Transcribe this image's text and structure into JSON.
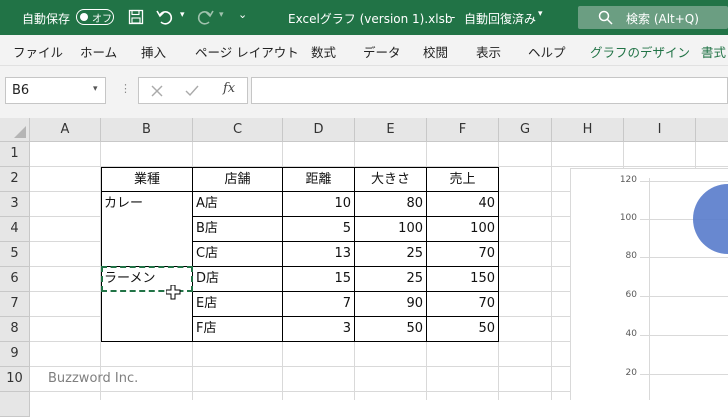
{
  "titlebar": {
    "autosave_label": "自動保存",
    "autosave_state": "オフ",
    "file_title": "Excelグラフ (version 1).xlsb",
    "save_status": "自動回復済み",
    "search_placeholder": "検索 (Alt+Q)"
  },
  "ribbon": {
    "tabs": [
      "ファイル",
      "ホーム",
      "挿入",
      "ページ レイアウト",
      "数式",
      "データ",
      "校閲",
      "表示",
      "ヘルプ",
      "グラフのデザイン",
      "書式"
    ]
  },
  "formula_bar": {
    "name_box": "B6",
    "fx": "fx",
    "value": ""
  },
  "grid": {
    "columns": [
      "A",
      "B",
      "C",
      "D",
      "E",
      "F",
      "G",
      "H",
      "I"
    ],
    "rows": [
      "1",
      "2",
      "3",
      "4",
      "5",
      "6",
      "7",
      "8",
      "9",
      "10"
    ],
    "table": {
      "headers": [
        "業種",
        "店舗",
        "距離",
        "大きさ",
        "売上"
      ],
      "rows": [
        [
          "カレー",
          "A店",
          "10",
          "80",
          "40"
        ],
        [
          "",
          "B店",
          "5",
          "100",
          "100"
        ],
        [
          "",
          "C店",
          "13",
          "25",
          "70"
        ],
        [
          "ラーメン",
          "D店",
          "15",
          "25",
          "150"
        ],
        [
          "",
          "E店",
          "7",
          "90",
          "70"
        ],
        [
          "",
          "F店",
          "3",
          "50",
          "50"
        ]
      ]
    }
  },
  "chart": {
    "y_ticks": [
      "120",
      "100",
      "80",
      "60",
      "40",
      "20"
    ],
    "colors": {
      "bubble": "#5b7ecc"
    },
    "chart_data": {
      "type": "scatter",
      "y_ticks": [
        120,
        100,
        80,
        60,
        40,
        20
      ]
    }
  },
  "watermark": "Buzzword Inc.",
  "colors": {
    "titlebar": "#217346",
    "accent": "#217346"
  }
}
